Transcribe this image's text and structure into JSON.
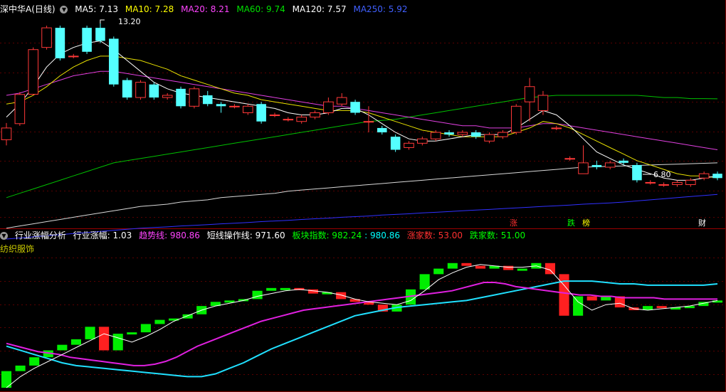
{
  "main": {
    "stock_name": "深中华A(日线)",
    "ma": [
      {
        "label": "MA5: 7.13",
        "color": "#ffffff"
      },
      {
        "label": "MA10: 7.28",
        "color": "#ffff00"
      },
      {
        "label": "MA20: 8.21",
        "color": "#ff44ff"
      },
      {
        "label": "MA60: 9.74",
        "color": "#00e000"
      },
      {
        "label": "MA120: 7.57",
        "color": "#ffffff"
      },
      {
        "label": "MA250: 5.92",
        "color": "#4040ff"
      }
    ],
    "high_label": "13.20",
    "low_label": "6.80",
    "events": [
      {
        "text": "涨",
        "color": "#ff3030"
      },
      {
        "text": "跌",
        "color": "#00ff00"
      },
      {
        "text": "榜",
        "color": "#ffff00"
      },
      {
        "text": "财",
        "color": "#ffffff"
      }
    ],
    "candles": [
      [
        7.86,
        8.4,
        7.6,
        8.63
      ],
      [
        8.6,
        9.94,
        8.5,
        10.05
      ],
      [
        9.95,
        12.0,
        9.9,
        12.1
      ],
      [
        12.1,
        13.0,
        12.0,
        13.1
      ],
      [
        13.0,
        11.6,
        11.5,
        13.1
      ],
      [
        11.7,
        11.7,
        11.6,
        11.8
      ],
      [
        13.0,
        11.9,
        11.8,
        13.1
      ],
      [
        13.0,
        12.4,
        12.3,
        13.2
      ],
      [
        12.5,
        10.4,
        10.3,
        12.6
      ],
      [
        10.6,
        9.8,
        9.7,
        10.7
      ],
      [
        9.8,
        10.5,
        9.7,
        10.6
      ],
      [
        10.4,
        9.8,
        9.7,
        10.5
      ],
      [
        9.8,
        9.9,
        9.7,
        10.0
      ],
      [
        10.2,
        9.4,
        9.3,
        10.3
      ],
      [
        9.4,
        10.2,
        9.3,
        10.3
      ],
      [
        9.9,
        9.5,
        9.4,
        10.1
      ],
      [
        9.5,
        9.4,
        9.1,
        9.6
      ],
      [
        9.4,
        9.4,
        9.3,
        9.5
      ],
      [
        9.1,
        9.4,
        9.0,
        9.5
      ],
      [
        9.5,
        8.7,
        8.6,
        9.6
      ],
      [
        9.0,
        9.0,
        8.9,
        9.1
      ],
      [
        8.8,
        8.8,
        8.7,
        8.9
      ],
      [
        8.7,
        8.9,
        8.6,
        9.0
      ],
      [
        8.9,
        9.1,
        8.8,
        9.2
      ],
      [
        9.1,
        9.6,
        9.0,
        9.8
      ],
      [
        9.5,
        9.8,
        9.4,
        10.0
      ],
      [
        9.6,
        9.1,
        9.0,
        9.7
      ],
      [
        8.7,
        8.7,
        8.2,
        9.4
      ],
      [
        8.4,
        8.2,
        8.1,
        8.5
      ],
      [
        8.0,
        7.4,
        7.3,
        8.1
      ],
      [
        7.5,
        7.7,
        7.4,
        7.8
      ],
      [
        7.7,
        7.9,
        7.6,
        8.0
      ],
      [
        7.9,
        8.2,
        7.8,
        8.3
      ],
      [
        8.2,
        8.1,
        8.0,
        8.3
      ],
      [
        8.1,
        8.2,
        8.0,
        8.3
      ],
      [
        8.2,
        8.0,
        7.9,
        8.3
      ],
      [
        7.8,
        8.1,
        7.7,
        8.2
      ],
      [
        8.0,
        8.2,
        7.9,
        8.3
      ],
      [
        8.2,
        9.4,
        8.1,
        9.5
      ],
      [
        9.6,
        10.3,
        8.7,
        10.7
      ],
      [
        9.2,
        9.9,
        9.0,
        10.1
      ],
      [
        8.4,
        8.4,
        8.3,
        8.5
      ],
      [
        7.0,
        7.0,
        6.9,
        7.1
      ],
      [
        6.3,
        6.8,
        6.3,
        7.6
      ],
      [
        6.7,
        6.6,
        6.5,
        6.9
      ],
      [
        6.6,
        6.8,
        6.5,
        6.9
      ],
      [
        6.9,
        6.8,
        6.7,
        7.0
      ],
      [
        6.7,
        6.0,
        5.9,
        6.8
      ],
      [
        5.9,
        5.9,
        5.8,
        6.0
      ],
      [
        5.8,
        5.8,
        5.7,
        5.9
      ],
      [
        5.8,
        5.9,
        5.7,
        6.0
      ],
      [
        5.8,
        6.0,
        5.7,
        6.1
      ],
      [
        6.1,
        6.3,
        6.0,
        6.4
      ],
      [
        6.3,
        6.1,
        6.0,
        6.4
      ]
    ],
    "ma5": [
      8.9,
      9.5,
      10.3,
      11.2,
      11.8,
      12.1,
      12.3,
      12.4,
      12.0,
      11.5,
      11.0,
      10.5,
      10.2,
      10.0,
      9.9,
      9.8,
      9.7,
      9.6,
      9.5,
      9.4,
      9.3,
      9.1,
      9.0,
      9.0,
      9.1,
      9.3,
      9.3,
      9.0,
      8.6,
      8.2,
      7.9,
      7.8,
      7.8,
      7.9,
      8.0,
      8.1,
      8.1,
      8.1,
      8.4,
      8.8,
      9.2,
      9.0,
      8.5,
      7.9,
      7.3,
      7.0,
      6.7,
      6.5,
      6.3,
      6.1,
      6.0,
      6.0,
      6.1,
      6.2
    ],
    "ma10": [
      9.5,
      9.6,
      9.9,
      10.3,
      10.8,
      11.2,
      11.5,
      11.7,
      11.7,
      11.6,
      11.5,
      11.3,
      11.1,
      10.8,
      10.6,
      10.4,
      10.2,
      10.0,
      9.9,
      9.7,
      9.6,
      9.5,
      9.4,
      9.3,
      9.2,
      9.2,
      9.2,
      9.1,
      8.9,
      8.7,
      8.5,
      8.3,
      8.2,
      8.1,
      8.0,
      8.0,
      8.0,
      8.0,
      8.2,
      8.4,
      8.7,
      8.6,
      8.4,
      8.1,
      7.8,
      7.5,
      7.2,
      6.9,
      6.7,
      6.5,
      6.3,
      6.2,
      6.2,
      6.1
    ],
    "ma20": [
      9.9,
      10.0,
      10.2,
      10.4,
      10.6,
      10.8,
      10.9,
      11.0,
      11.0,
      10.9,
      10.8,
      10.7,
      10.6,
      10.5,
      10.4,
      10.3,
      10.2,
      10.1,
      10.0,
      9.9,
      9.8,
      9.7,
      9.6,
      9.5,
      9.4,
      9.4,
      9.3,
      9.2,
      9.1,
      9.0,
      8.9,
      8.8,
      8.7,
      8.6,
      8.5,
      8.5,
      8.4,
      8.4,
      8.4,
      8.5,
      8.6,
      8.6,
      8.5,
      8.4,
      8.3,
      8.2,
      8.1,
      8.0,
      7.9,
      7.8,
      7.7,
      7.6,
      7.5,
      7.4
    ],
    "ma60": [
      5.2,
      5.4,
      5.6,
      5.8,
      6.0,
      6.2,
      6.4,
      6.6,
      6.8,
      6.9,
      7.0,
      7.1,
      7.2,
      7.3,
      7.4,
      7.5,
      7.6,
      7.7,
      7.8,
      7.9,
      8.0,
      8.1,
      8.2,
      8.3,
      8.4,
      8.5,
      8.6,
      8.7,
      8.75,
      8.8,
      8.9,
      9.0,
      9.1,
      9.2,
      9.3,
      9.4,
      9.5,
      9.6,
      9.7,
      9.8,
      9.85,
      9.9,
      9.9,
      9.9,
      9.9,
      9.9,
      9.9,
      9.9,
      9.85,
      9.8,
      9.8,
      9.75,
      9.75,
      9.74
    ],
    "ma120": [
      3.8,
      3.9,
      4.0,
      4.1,
      4.2,
      4.3,
      4.4,
      4.5,
      4.6,
      4.7,
      4.8,
      4.85,
      4.9,
      5.0,
      5.05,
      5.1,
      5.2,
      5.25,
      5.3,
      5.35,
      5.4,
      5.5,
      5.55,
      5.6,
      5.65,
      5.7,
      5.75,
      5.8,
      5.85,
      5.9,
      5.95,
      6.0,
      6.05,
      6.1,
      6.15,
      6.2,
      6.25,
      6.3,
      6.35,
      6.4,
      6.45,
      6.5,
      6.55,
      6.6,
      6.62,
      6.64,
      6.66,
      6.68,
      6.7,
      6.72,
      6.74,
      6.76,
      6.78,
      6.8
    ],
    "ma250": [
      3.3,
      3.35,
      3.4,
      3.45,
      3.5,
      3.55,
      3.6,
      3.65,
      3.7,
      3.75,
      3.8,
      3.83,
      3.86,
      3.9,
      3.93,
      3.96,
      4.0,
      4.03,
      4.06,
      4.1,
      4.13,
      4.16,
      4.2,
      4.23,
      4.26,
      4.3,
      4.33,
      4.36,
      4.4,
      4.43,
      4.46,
      4.5,
      4.53,
      4.56,
      4.6,
      4.63,
      4.66,
      4.7,
      4.73,
      4.76,
      4.8,
      4.83,
      4.86,
      4.9,
      4.93,
      4.96,
      5.0,
      5.05,
      5.1,
      5.15,
      5.2,
      5.25,
      5.3,
      5.35
    ]
  },
  "indicator": {
    "name": "行业涨幅分析",
    "sector": "纺织服饰",
    "values": [
      {
        "label": "行业涨幅: 1.03",
        "color": "#ffffff"
      },
      {
        "label": "趋势线: 980.86",
        "color": "#ff44ff"
      },
      {
        "label": "短线操作线: 971.60",
        "color": "#ffffff"
      },
      {
        "label": "板块指数: 982.24",
        "color": "#00ff00"
      },
      {
        "label": ": 980.86",
        "color": "#00ffff"
      },
      {
        "label": "涨家数: 53.00",
        "color": "#ff3030"
      },
      {
        "label": "跌家数: 51.00",
        "color": "#00ff00"
      }
    ],
    "bars": [
      [
        936,
        948
      ],
      [
        948,
        952
      ],
      [
        952,
        958
      ],
      [
        958,
        963
      ],
      [
        963,
        967
      ],
      [
        967,
        971
      ],
      [
        971,
        980
      ],
      [
        980,
        963
      ],
      [
        963,
        975
      ],
      [
        975,
        976
      ],
      [
        976,
        982
      ],
      [
        982,
        985
      ],
      [
        985,
        986
      ],
      [
        986,
        989
      ],
      [
        989,
        995
      ],
      [
        995,
        998
      ],
      [
        998,
        999
      ],
      [
        999,
        1000
      ],
      [
        1000,
        1006
      ],
      [
        1006,
        1008
      ],
      [
        1008,
        1008
      ],
      [
        1008,
        1007
      ],
      [
        1007,
        1004
      ],
      [
        1004,
        1005
      ],
      [
        1005,
        1000
      ],
      [
        1000,
        998
      ],
      [
        998,
        996
      ],
      [
        996,
        991
      ],
      [
        991,
        996
      ],
      [
        996,
        1007
      ],
      [
        1007,
        1018
      ],
      [
        1018,
        1022
      ],
      [
        1022,
        1026
      ],
      [
        1026,
        1024
      ],
      [
        1024,
        1022
      ],
      [
        1022,
        1024
      ],
      [
        1024,
        1021
      ],
      [
        1021,
        1022
      ],
      [
        1022,
        1026
      ],
      [
        1026,
        1018
      ],
      [
        1018,
        988
      ],
      [
        988,
        1002
      ],
      [
        1002,
        999
      ],
      [
        999,
        1002
      ],
      [
        1002,
        994
      ],
      [
        994,
        992
      ],
      [
        992,
        995
      ],
      [
        995,
        994
      ],
      [
        994,
        994
      ],
      [
        994,
        995
      ],
      [
        995,
        998
      ],
      [
        998,
        999
      ]
    ],
    "trend": [
      968,
      966,
      964,
      962,
      961,
      960,
      958,
      957,
      956,
      955,
      954,
      953,
      952,
      952,
      953,
      955,
      958,
      962,
      966,
      969,
      972,
      975,
      978,
      981,
      984,
      986,
      988,
      990,
      992,
      993,
      994,
      995,
      996,
      997,
      998,
      999,
      1000,
      1001,
      1002,
      1003,
      1004,
      1005,
      1006,
      1008,
      1010,
      1012,
      1012,
      1011,
      1009,
      1008,
      1007,
      1006,
      1005,
      1004,
      1003,
      1003,
      1002,
      1002,
      1001,
      1001,
      1001,
      1001,
      1000,
      1000,
      1000,
      1000,
      1000,
      1000
    ],
    "short": [
      936,
      944,
      950,
      955,
      960,
      965,
      970,
      975,
      972,
      969,
      973,
      978,
      984,
      988,
      992,
      995,
      997,
      999,
      1002,
      1004,
      1006,
      1007,
      1006,
      1005,
      1003,
      1000,
      998,
      997,
      996,
      999,
      1006,
      1014,
      1019,
      1023,
      1025,
      1024,
      1023,
      1023,
      1024,
      1021,
      1010,
      998,
      992,
      996,
      997,
      993,
      992,
      993,
      994,
      995,
      997,
      999
    ],
    "cyan": [
      966,
      963,
      960,
      957,
      954,
      952,
      951,
      950,
      949,
      948,
      947,
      946,
      945,
      944,
      944,
      946,
      950,
      954,
      959,
      964,
      968,
      972,
      976,
      980,
      984,
      988,
      990,
      992,
      994,
      995,
      996,
      997,
      998,
      999,
      1001,
      1003,
      1005,
      1007,
      1009,
      1011,
      1013,
      1013,
      1013,
      1012,
      1011,
      1011,
      1010,
      1010,
      1010,
      1010,
      1010,
      1011
    ]
  }
}
